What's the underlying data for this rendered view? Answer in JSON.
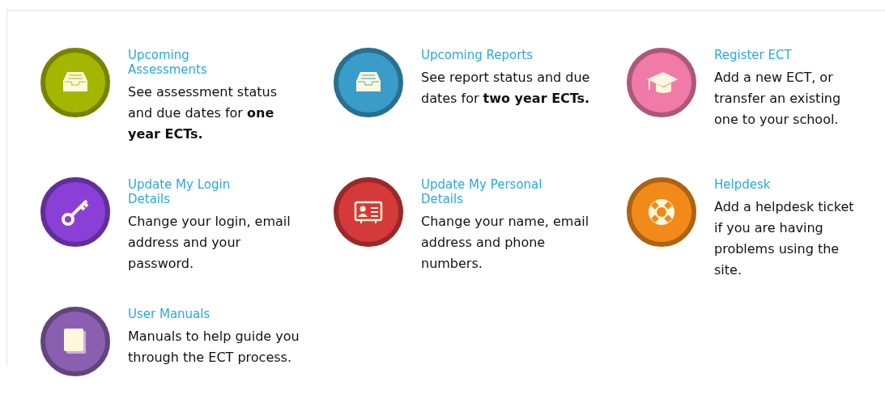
{
  "items": [
    {
      "title": "Upcoming Assessments",
      "description": "See assessment status and due dates for **one year ECTs.**",
      "color": "#a5b600"
    },
    {
      "title": "Upcoming Reports",
      "description": "See report status and due dates for **two year ECTs.**",
      "color": "#3a9cc8"
    },
    {
      "title": "Register ECT",
      "description": "Add a new ECT, or transfer an existing one to your school.",
      "color": "#f07aa8"
    },
    {
      "title": "Update My Login Details",
      "description": "Change your login, email address and your password.",
      "color": "#8a3fd6"
    },
    {
      "title": "Update My Personal Details",
      "description": "Change your name, email address and phone numbers.",
      "color": "#d43a3a"
    },
    {
      "title": "Helpdesk",
      "description": "Add a helpdesk ticket if you are having problems using the site.",
      "color": "#f28a1a"
    },
    {
      "title": "User Manuals",
      "description": "Manuals to help guide you through the ECT process.",
      "color": "#8b5fb0"
    }
  ]
}
